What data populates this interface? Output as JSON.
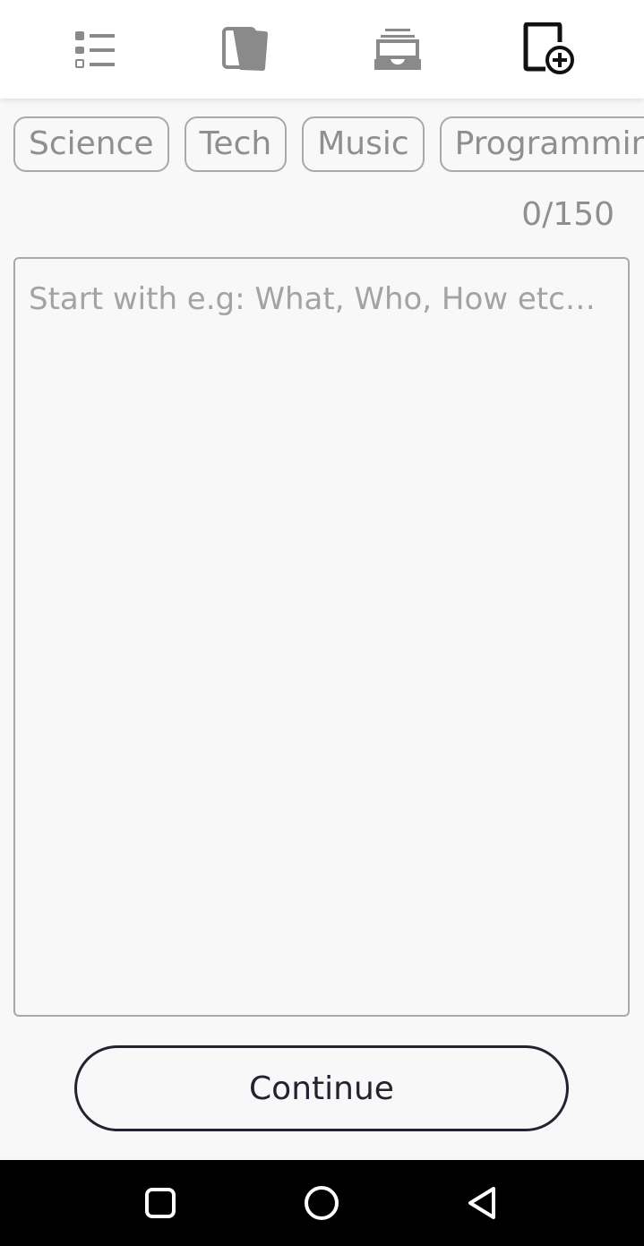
{
  "tabs": [
    {
      "icon": "list-icon",
      "active": false
    },
    {
      "icon": "cards-icon",
      "active": false
    },
    {
      "icon": "inbox-icon",
      "active": false
    },
    {
      "icon": "add-card-icon",
      "active": true
    }
  ],
  "categories": [
    "Science",
    "Tech",
    "Music",
    "Programming"
  ],
  "counter": "0/150",
  "question": {
    "value": "",
    "placeholder": "Start with e.g: What, Who, How etc…"
  },
  "continue_label": "Continue",
  "colors": {
    "inactive_icon": "#8a8a8a",
    "active_icon": "#111111",
    "chip_border": "#a9a9a9",
    "button_border": "#23232f"
  },
  "system_nav": [
    "square-icon",
    "circle-icon",
    "triangle-back-icon"
  ]
}
